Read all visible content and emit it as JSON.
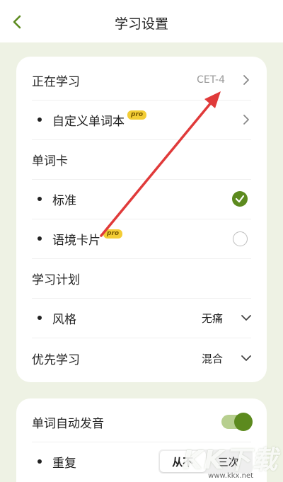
{
  "header": {
    "title": "学习设置",
    "back_icon": "chevron-left-icon"
  },
  "colors": {
    "accent": "#5c8a1e",
    "accent_light": "#b7cf8f",
    "pro_badge": "#f3cd35",
    "arrow": "#e03a3a",
    "background": "#eef2e4"
  },
  "settings": {
    "current_study": {
      "label": "正在学习",
      "value": "CET-4"
    },
    "custom_wordbook": {
      "label": "自定义单词本",
      "badge": "pro"
    },
    "word_card_section": {
      "label": "单词卡"
    },
    "standard": {
      "label": "标准",
      "selected": true
    },
    "context_card": {
      "label": "语境卡片",
      "badge": "pro",
      "selected": false
    },
    "study_plan_section": {
      "label": "学习计划"
    },
    "style": {
      "label": "风格",
      "value": "无痛"
    },
    "priority": {
      "label": "优先学习",
      "value": "混合"
    }
  },
  "audio": {
    "auto_pronounce": {
      "label": "单词自动发音",
      "enabled": true
    },
    "repeat": {
      "label": "重复",
      "options": [
        "从不",
        "三次"
      ],
      "selected": "从不"
    }
  },
  "watermark": {
    "logo": "KK下载",
    "url": "www.kkx.net"
  }
}
